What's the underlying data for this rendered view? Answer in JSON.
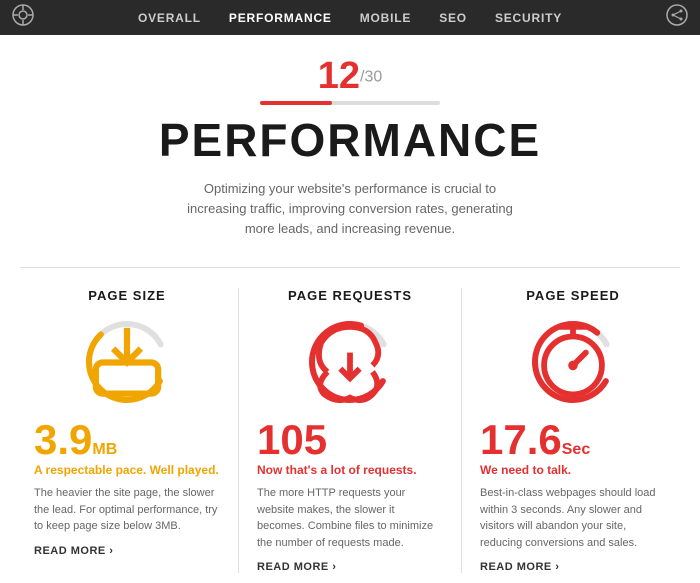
{
  "header": {
    "nav": [
      {
        "label": "OVERALL",
        "active": false
      },
      {
        "label": "PERFORMANCE",
        "active": true
      },
      {
        "label": "MOBILE",
        "active": false
      },
      {
        "label": "SEO",
        "active": false
      },
      {
        "label": "SECURITY",
        "active": false
      }
    ],
    "left_icon": "gauge-icon",
    "right_icon": "share-icon"
  },
  "score": {
    "value": "12",
    "total": "/30",
    "bar_pct": 40
  },
  "title": "PERFORMANCE",
  "description": "Optimizing your website's performance is crucial to increasing traffic, improving conversion rates, generating more leads, and increasing revenue.",
  "cards": [
    {
      "id": "page-size",
      "title": "PAGE SIZE",
      "value": "3.9",
      "unit": "MB",
      "color": "yellow",
      "status": "A respectable pace. Well played.",
      "status_color": "yellow",
      "desc": "The heavier the site page, the slower the lead. For optimal performance, try to keep page size below 3MB.",
      "read_more": "READ MORE"
    },
    {
      "id": "page-requests",
      "title": "PAGE REQUESTS",
      "value": "105",
      "unit": "",
      "color": "red",
      "status": "Now that's a lot of requests.",
      "status_color": "red",
      "desc": "The more HTTP requests your website makes, the slower it becomes. Combine files to minimize the number of requests made.",
      "read_more": "READ MORE"
    },
    {
      "id": "page-speed",
      "title": "PAGE SPEED",
      "value": "17.6",
      "unit": "Sec",
      "color": "red",
      "status": "We need to talk.",
      "status_color": "red",
      "desc": "Best-in-class webpages should load within 3 seconds. Any slower and visitors will abandon your site, reducing conversions and sales.",
      "read_more": "READ MORE"
    }
  ],
  "gauges": {
    "page_size": {
      "pct": 65,
      "color": "#f0a500",
      "icon": "⬇",
      "icon_color": "#f0a500"
    },
    "page_requests": {
      "pct": 85,
      "color": "#e53030",
      "icon": "☁",
      "icon_color": "#e53030"
    },
    "page_speed": {
      "pct": 90,
      "color": "#e53030",
      "icon": "⏱",
      "icon_color": "#e53030"
    }
  }
}
